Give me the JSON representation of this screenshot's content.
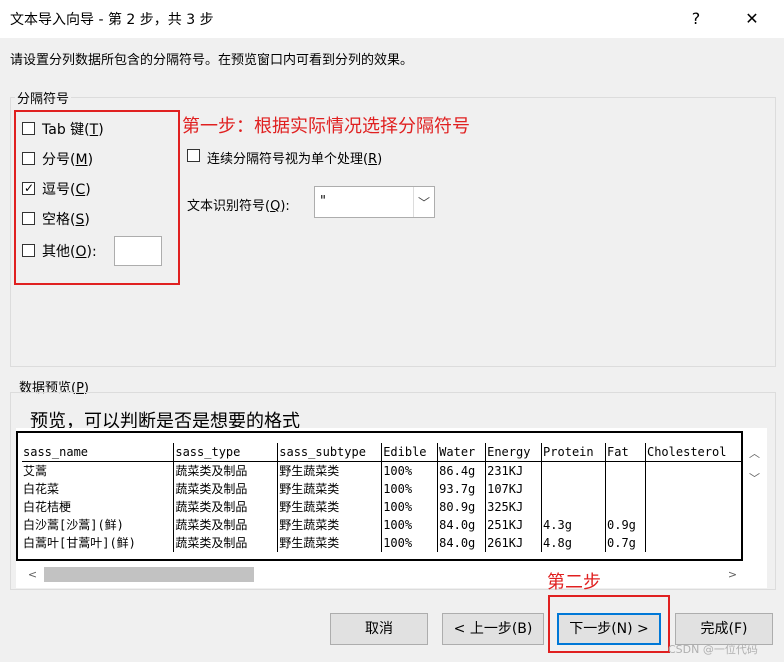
{
  "window": {
    "title": "文本导入向导 - 第 2 步，共 3 步",
    "help_label": "?",
    "close_label": "✕"
  },
  "instruction": "请设置分列数据所包含的分隔符号。在预览窗口内可看到分列的效果。",
  "delimiters": {
    "group_title": "分隔符号",
    "tab": {
      "label": "Tab 键(",
      "key": "T",
      "suffix": ")",
      "checked": false
    },
    "semicolon": {
      "label": "分号(",
      "key": "M",
      "suffix": ")",
      "checked": false
    },
    "comma": {
      "label": "逗号(",
      "key": "C",
      "suffix": ")",
      "checked": true
    },
    "space": {
      "label": "空格(",
      "key": "S",
      "suffix": ")",
      "checked": false
    },
    "other": {
      "label": "其他(",
      "key": "O",
      "suffix": "):",
      "checked": false,
      "value": ""
    }
  },
  "consecutive": {
    "label": "连续分隔符号视为单个处理(",
    "key": "R",
    "suffix": ")",
    "checked": false
  },
  "text_qualifier": {
    "label": "文本识别符号(",
    "key": "Q",
    "suffix": "):",
    "value": "\""
  },
  "preview": {
    "group_title": "数据预览(",
    "key": "P",
    "suffix": ")"
  },
  "annotations": {
    "step1": "第一步：根据实际情况选择分隔符号",
    "preview_note": "预览，可以判断是否是想要的格式",
    "step2": "第二步"
  },
  "table": {
    "rows": [
      [
        "sass_name",
        "sass_type",
        "sass_subtype",
        "Edible",
        "Water",
        "Energy",
        "Protein",
        "Fat",
        "Cholesterol"
      ],
      [
        "艾蒿",
        "蔬菜类及制品",
        "野生蔬菜类",
        "100%",
        "86.4g",
        "231KJ",
        "",
        "",
        ""
      ],
      [
        "白花菜",
        "蔬菜类及制品",
        "野生蔬菜类",
        "100%",
        "93.7g",
        "107KJ",
        "",
        "",
        ""
      ],
      [
        "白花桔梗",
        "蔬菜类及制品",
        "野生蔬菜类",
        "100%",
        "80.9g",
        "325KJ",
        "",
        "",
        ""
      ],
      [
        "白沙蒿[沙蒿](鲜)",
        "蔬菜类及制品",
        "野生蔬菜类",
        "100%",
        "84.0g",
        "251KJ",
        "4.3g",
        "0.9g",
        ""
      ],
      [
        "白蒿叶[甘蒿叶](鲜)",
        "蔬菜类及制品",
        "野生蔬菜类",
        "100%",
        "84.0g",
        "261KJ",
        "4.8g",
        "0.7g",
        ""
      ]
    ]
  },
  "buttons": {
    "cancel": "取消",
    "back": "< 上一步(B)",
    "next": "下一步(N) >",
    "finish": "完成(F)"
  },
  "watermark": "CSDN @一位代码"
}
